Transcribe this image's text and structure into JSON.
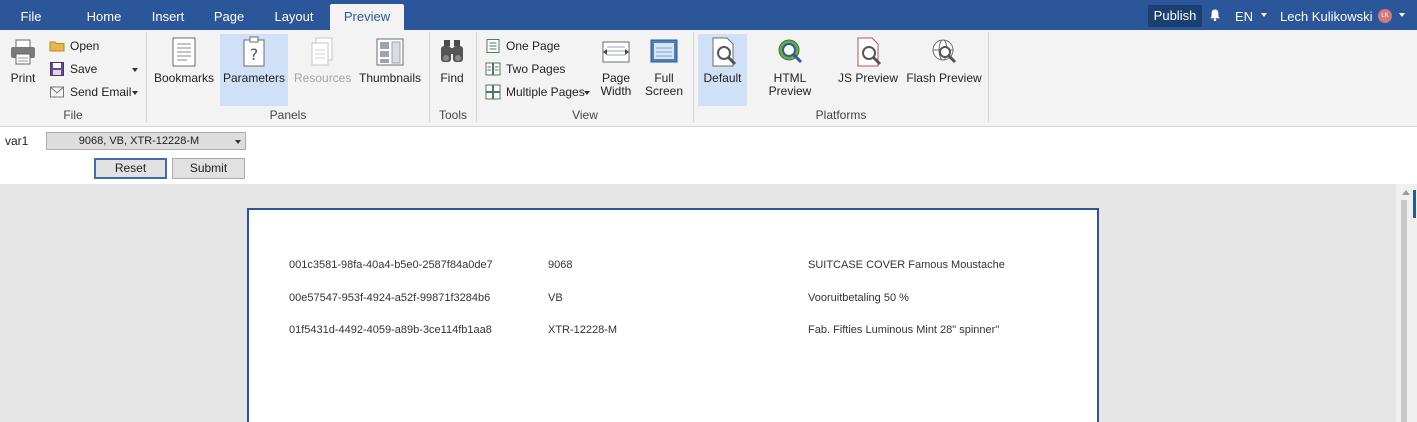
{
  "menubar": {
    "tabs": [
      {
        "label": "File"
      },
      {
        "label": "Home"
      },
      {
        "label": "Insert"
      },
      {
        "label": "Page"
      },
      {
        "label": "Layout"
      },
      {
        "label": "Preview",
        "active": true
      }
    ],
    "publish_label": "Publish",
    "language": "EN",
    "user_name": "Lech Kulikowski",
    "user_initials": "LK"
  },
  "ribbon": {
    "file": {
      "print_label": "Print",
      "open_label": "Open",
      "save_label": "Save",
      "send_email_label": "Send Email",
      "group_label": "File"
    },
    "panels": {
      "bookmarks_label": "Bookmarks",
      "parameters_label": "Parameters",
      "resources_label": "Resources",
      "thumbnails_label": "Thumbnails",
      "group_label": "Panels"
    },
    "tools": {
      "find_label": "Find",
      "group_label": "Tools"
    },
    "view": {
      "one_page_label": "One Page",
      "two_pages_label": "Two Pages",
      "multiple_pages_label": "Multiple Pages",
      "page_width_label_1": "Page",
      "page_width_label_2": "Width",
      "full_screen_label_1": "Full",
      "full_screen_label_2": "Screen",
      "group_label": "View"
    },
    "platforms": {
      "default_label": "Default",
      "html_preview_label": "HTML Preview",
      "js_preview_label": "JS Preview",
      "flash_preview_label": "Flash Preview",
      "group_label": "Platforms"
    }
  },
  "parameters": {
    "var_label": "var1",
    "var_value": "9068, VB, XTR-12228-M",
    "reset_label": "Reset",
    "submit_label": "Submit"
  },
  "report": {
    "rows": [
      {
        "id": "001c3581-98fa-40a4-b5e0-2587f84a0de7",
        "code": "9068",
        "description": "SUITCASE COVER Famous Moustache"
      },
      {
        "id": "00e57547-953f-4924-a52f-99871f3284b6",
        "code": "VB",
        "description": "Vooruitbetaling 50 %"
      },
      {
        "id": "01f5431d-4492-4059-a89b-3ce114fb1aa8",
        "code": "XTR-12228-M",
        "description": "Fab. Fifties Luminous Mint 28\" spinner\""
      }
    ]
  },
  "colors": {
    "accent": "#2b579a",
    "ribbon_bg": "#f3f3f3",
    "selected_bg": "#cfe0f7",
    "viewer_bg": "#e6e6e6"
  }
}
